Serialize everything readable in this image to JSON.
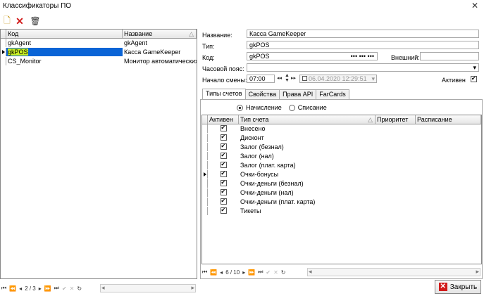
{
  "window": {
    "title": "Классификаторы ПО",
    "close": "✕"
  },
  "toolbar": {
    "new": "🗋",
    "delete": "✕",
    "trash": "🗑"
  },
  "left_grid": {
    "col_code": "Код",
    "col_name": "Название",
    "sort_glyph": "△",
    "rows": [
      {
        "code": "gkAgent",
        "name": "gkAgent"
      },
      {
        "code": "gkPOS",
        "name": "Касса GameKeeper"
      },
      {
        "code": "CS_Monitor",
        "name": "Монитор автоматических"
      }
    ],
    "nav_counter": "2 / 3"
  },
  "form": {
    "name_label": "Название:",
    "name_value": "Касса GameKeeper",
    "type_label": "Тип:",
    "type_value": "gkPOS",
    "code_label": "Код:",
    "code_value": "gkPOS",
    "code_dots": "••• ••• •••",
    "external_label": "Внешний:",
    "external_value": "",
    "timezone_label": "Часовой пояс:",
    "timezone_value": "",
    "shift_label": "Начало смены:",
    "shift_time": "07:00",
    "shift_date": "06.04.2020 12:29:51",
    "active_label": "Активен"
  },
  "tabs": [
    "Типы счетов",
    "Свойства",
    "Права API",
    "FarCards"
  ],
  "mode": {
    "accrual": "Начисление",
    "writeoff": "Списание"
  },
  "accounts_grid": {
    "col_active": "Активен",
    "col_type": "Тип счета",
    "col_priority": "Приоритет",
    "col_schedule": "Расписание",
    "sort_glyph": "△",
    "rows": [
      "Внесено",
      "Дисконт",
      "Залог (безнал)",
      "Залог (нал)",
      "Залог (плат. карта)",
      "Очки-бонусы",
      "Очки-деньги (безнал)",
      "Очки-деньги (нал)",
      "Очки-деньги (плат. карта)",
      "Тикеты"
    ],
    "nav_counter": "6 / 10"
  },
  "close_button": "Закрыть"
}
